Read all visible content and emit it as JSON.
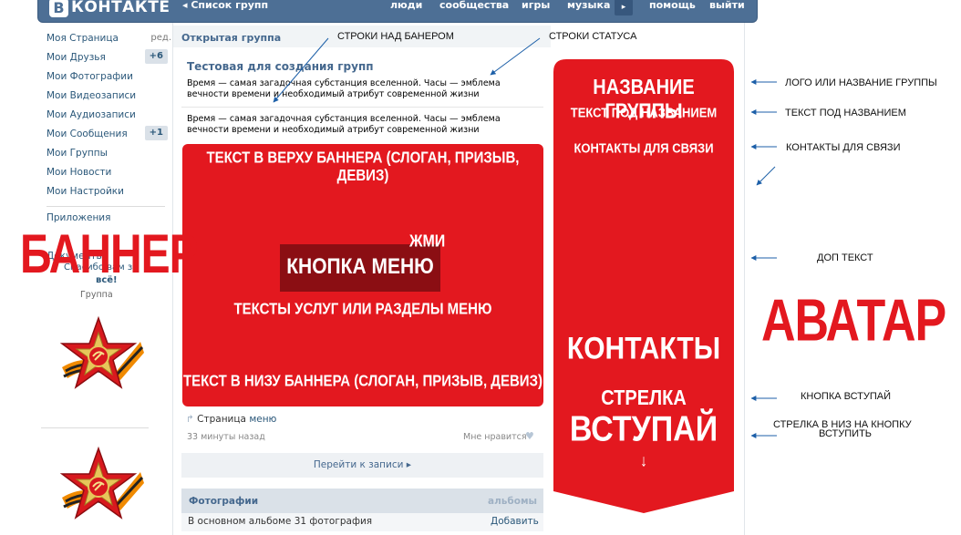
{
  "topbar": {
    "logo_letter": "В",
    "logo_text": "КОНТАКТЕ",
    "back_link": "◂ Список групп",
    "nav": [
      "люди",
      "сообщества",
      "игры",
      "музыка",
      "помощь",
      "выйти"
    ],
    "nav_arrow": "▸"
  },
  "sidebar": {
    "items": [
      {
        "label": "Моя Страница",
        "extra": "ред."
      },
      {
        "label": "Мои Друзья",
        "badge": "+6"
      },
      {
        "label": "Мои Фотографии"
      },
      {
        "label": "Мои Видеозаписи"
      },
      {
        "label": "Мои Аудиозаписи"
      },
      {
        "label": "Мои Сообщения",
        "badge": "+1"
      },
      {
        "label": "Мои Группы"
      },
      {
        "label": "Мои Новости"
      },
      {
        "label": "Мои Настройки"
      }
    ],
    "apps": "Приложения",
    "docs": "Документы",
    "ghost_text": "Спасибо вам за",
    "ghost_text2": "всё!",
    "group_label": "Группа"
  },
  "group": {
    "type": "Открытая группа",
    "name": "Тестовая для создания групп",
    "status_1": "Время — самая загадочная субстанция вселенной. Часы — эмблема вечности времени и необходимый атрибут современной жизни",
    "status_2": "Время — самая загадочная субстанция вселенной. Часы — эмблема вечности времени и необходимый атрибут современной жизни"
  },
  "banner": {
    "top_text": "ТЕКСТ В ВЕРХУ БАННЕРА (СЛОГАН, ПРИЗЫВ, ДЕВИЗ)",
    "button": "КНОПКА МЕНЮ",
    "press": "ЖМИ",
    "services": "ТЕКСТЫ УСЛУГ ИЛИ РАЗДЕЛЫ МЕНЮ",
    "bottom_text": "ТЕКСТ В НИЗУ БАННЕРА (СЛОГАН, ПРИЗЫВ, ДЕВИЗ)"
  },
  "post": {
    "page_prefix": "Страница",
    "page_link": "меню",
    "time": "33 минуты назад",
    "likes": "Мне нравится",
    "goto": "Перейти к записи ▸"
  },
  "photos": {
    "title": "Фотографии",
    "albums": "альбомы",
    "info": "В основном альбоме 31 фотография",
    "add": "Добавить"
  },
  "avatar": {
    "name": "НАЗВАНИЕ ГРУППЫ",
    "subtitle": "ТЕКСТ ПОД НАЗВАНИЕМ",
    "contacts_link": "КОНТАКТЫ ДЛЯ СВЯЗИ",
    "contacts": "КОНТАКТЫ",
    "arrow_label": "СТРЕЛКА",
    "join": "ВСТУПАЙ",
    "down_arrow": "↓",
    "color": "#e3181f"
  },
  "annotations": {
    "above_banner": "СТРОКИ НАД БАНЕРОМ",
    "status_lines": "СТРОКИ СТАТУСА",
    "logo": "ЛОГО ИЛИ НАЗВАНИЕ ГРУППЫ",
    "under_name": "ТЕКСТ ПОД НАЗВАНИЕМ",
    "contacts": "КОНТАКТЫ ДЛЯ СВЯЗИ",
    "extra": "ДОП ТЕКСТ",
    "join_button": "КНОПКА ВСТУПАЙ",
    "arrow": "СТРЕЛКА В НИЗ НА КНОПКУ",
    "arrow2": "ВСТУПИТЬ",
    "banner_big": "БАННЕР",
    "avatar_big": "АВАТАР"
  }
}
